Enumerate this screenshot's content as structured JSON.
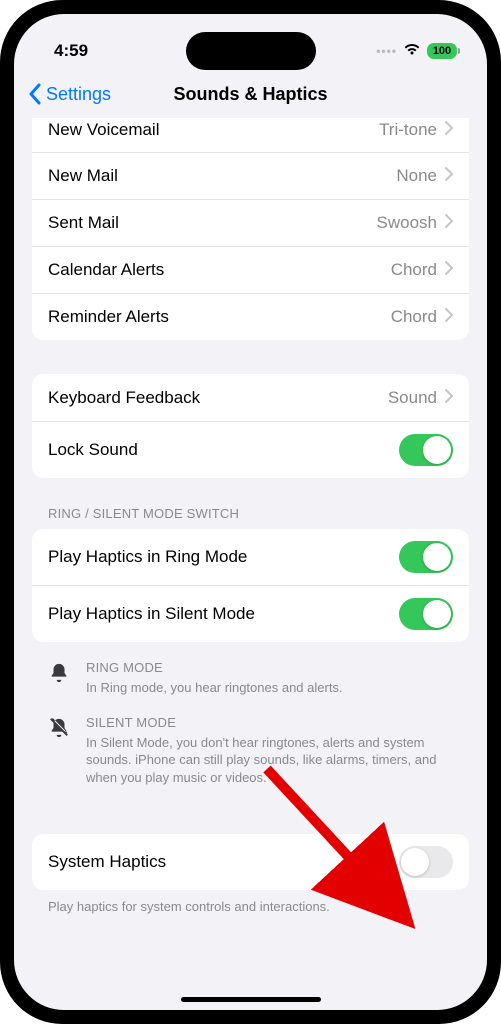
{
  "status": {
    "time": "4:59",
    "battery": "100"
  },
  "nav": {
    "back": "Settings",
    "title": "Sounds & Haptics"
  },
  "group1": {
    "items": [
      {
        "label": "New Voicemail",
        "value": "Tri-tone"
      },
      {
        "label": "New Mail",
        "value": "None"
      },
      {
        "label": "Sent Mail",
        "value": "Swoosh"
      },
      {
        "label": "Calendar Alerts",
        "value": "Chord"
      },
      {
        "label": "Reminder Alerts",
        "value": "Chord"
      }
    ]
  },
  "group2": {
    "keyboard_label": "Keyboard Feedback",
    "keyboard_value": "Sound",
    "lock_label": "Lock Sound"
  },
  "group3": {
    "header": "RING / SILENT MODE SWITCH",
    "ring_label": "Play Haptics in Ring Mode",
    "silent_label": "Play Haptics in Silent Mode"
  },
  "info": {
    "ring_title": "RING MODE",
    "ring_desc": "In Ring mode, you hear ringtones and alerts.",
    "silent_title": "SILENT MODE",
    "silent_desc": "In Silent Mode, you don't hear ringtones, alerts and system sounds. iPhone can still play sounds, like alarms, timers, and when you play music or videos."
  },
  "group4": {
    "label": "System Haptics",
    "footer": "Play haptics for system controls and interactions."
  }
}
